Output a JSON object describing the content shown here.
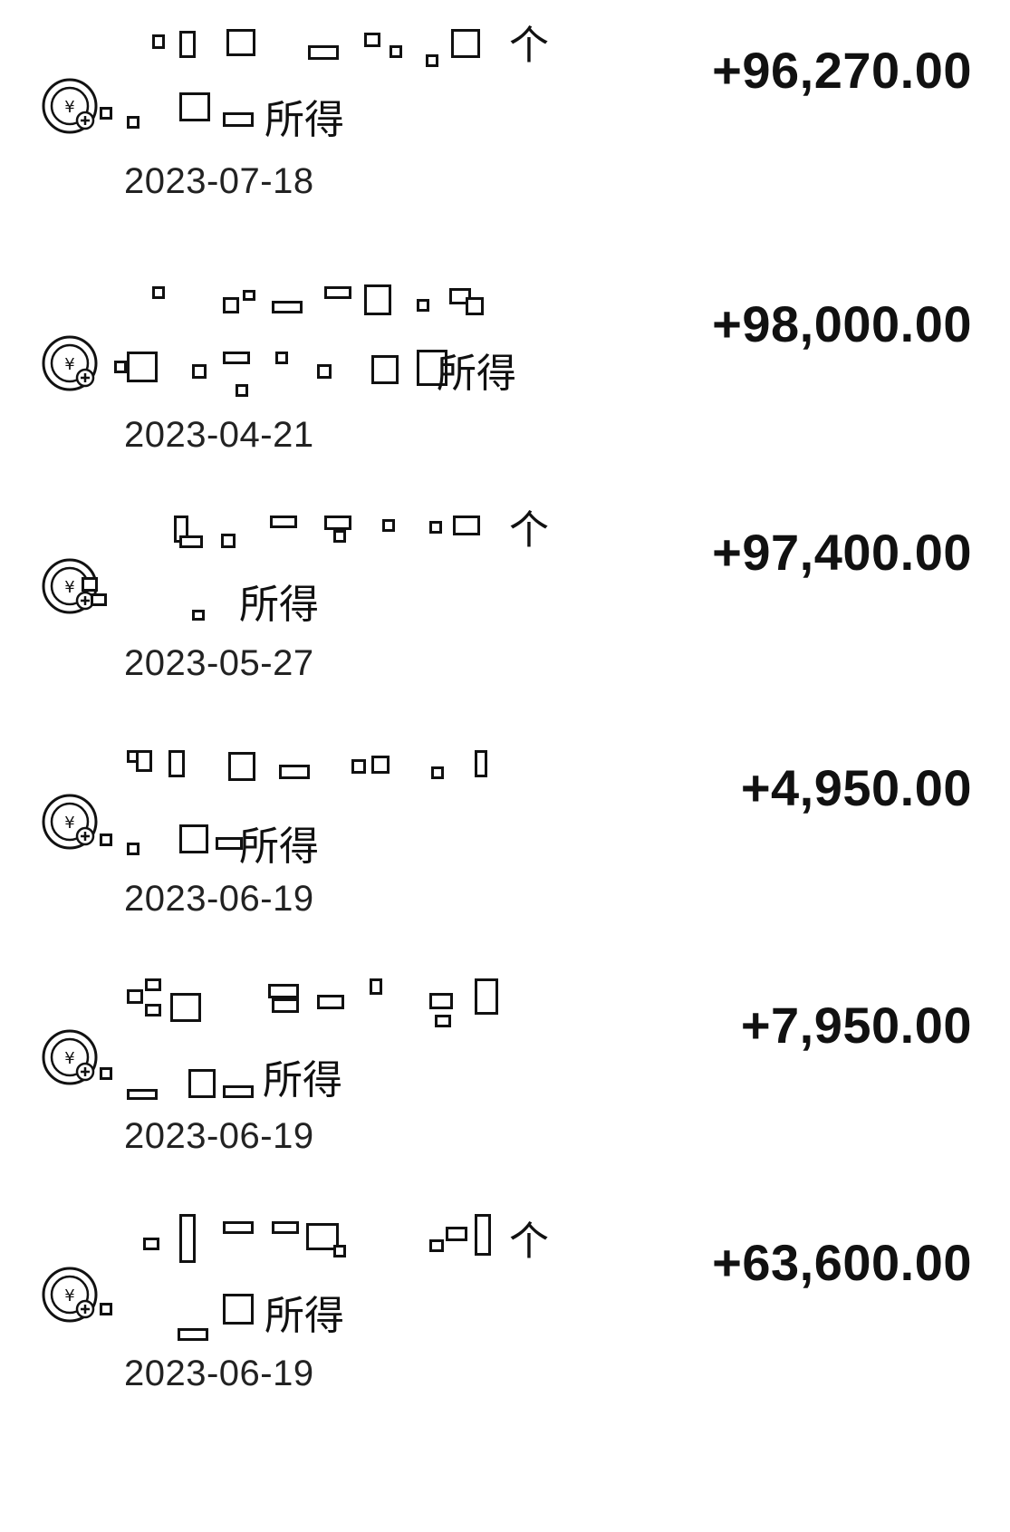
{
  "records": [
    {
      "title_suffix_line1": "个",
      "title_suffix_line2": "所得",
      "date": "2023-07-18",
      "amount": "+96,270.00",
      "icon": "income-tax-yuan-icon"
    },
    {
      "title_suffix_line1": "",
      "title_suffix_line2": "所得",
      "date": "2023-04-21",
      "amount": "+98,000.00",
      "icon": "income-tax-yuan-icon"
    },
    {
      "title_suffix_line1": "个",
      "title_suffix_line2": "所得",
      "date": "2023-05-27",
      "amount": "+97,400.00",
      "icon": "income-tax-yuan-icon"
    },
    {
      "title_suffix_line1": "",
      "title_suffix_line2": "所得",
      "date": "2023-06-19",
      "amount": "+4,950.00",
      "icon": "income-tax-yuan-icon"
    },
    {
      "title_suffix_line1": "",
      "title_suffix_line2": "所得",
      "date": "2023-06-19",
      "amount": "+7,950.00",
      "icon": "income-tax-yuan-icon"
    },
    {
      "title_suffix_line1": "个",
      "title_suffix_line2": "所得",
      "date": "2023-06-19",
      "amount": "+63,600.00",
      "icon": "income-tax-yuan-icon"
    }
  ]
}
